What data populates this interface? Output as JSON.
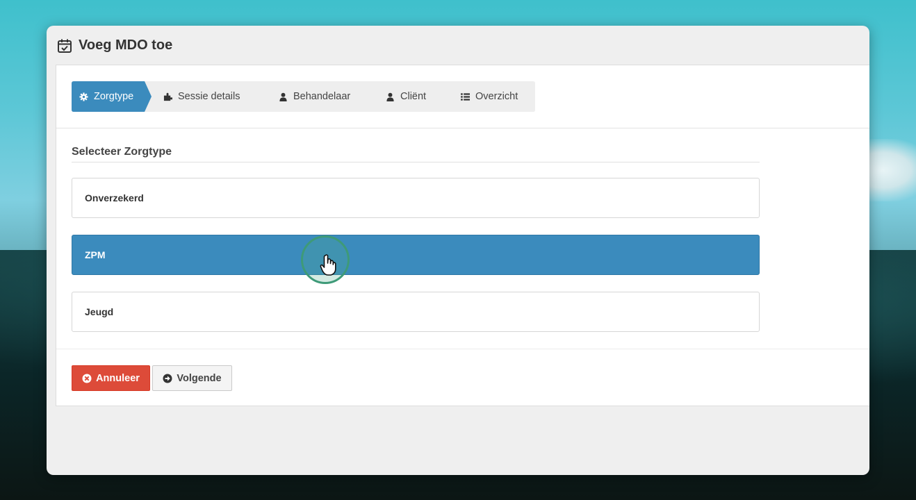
{
  "modal": {
    "title": "Voeg MDO toe",
    "title_icon": "calendar-check-icon"
  },
  "steps": [
    {
      "label": "Zorgtype",
      "icon": "gear-icon",
      "active": true
    },
    {
      "label": "Sessie details",
      "icon": "puzzle-icon",
      "active": false
    },
    {
      "label": "Behandelaar",
      "icon": "user-icon",
      "active": false
    },
    {
      "label": "Cliënt",
      "icon": "user-icon",
      "active": false
    },
    {
      "label": "Overzicht",
      "icon": "list-icon",
      "active": false
    }
  ],
  "section": {
    "title": "Selecteer Zorgtype"
  },
  "options": [
    {
      "label": "Onverzekerd",
      "selected": false
    },
    {
      "label": "ZPM",
      "selected": true
    },
    {
      "label": "Jeugd",
      "selected": false
    }
  ],
  "buttons": {
    "cancel_label": "Annuleer",
    "cancel_icon": "times-circle-icon",
    "next_label": "Volgende",
    "next_icon": "arrow-circle-right-icon"
  },
  "colors": {
    "active_step": "#3b8bbd",
    "selected_option": "#3b8bbd",
    "cancel_button": "#dd4b39"
  }
}
